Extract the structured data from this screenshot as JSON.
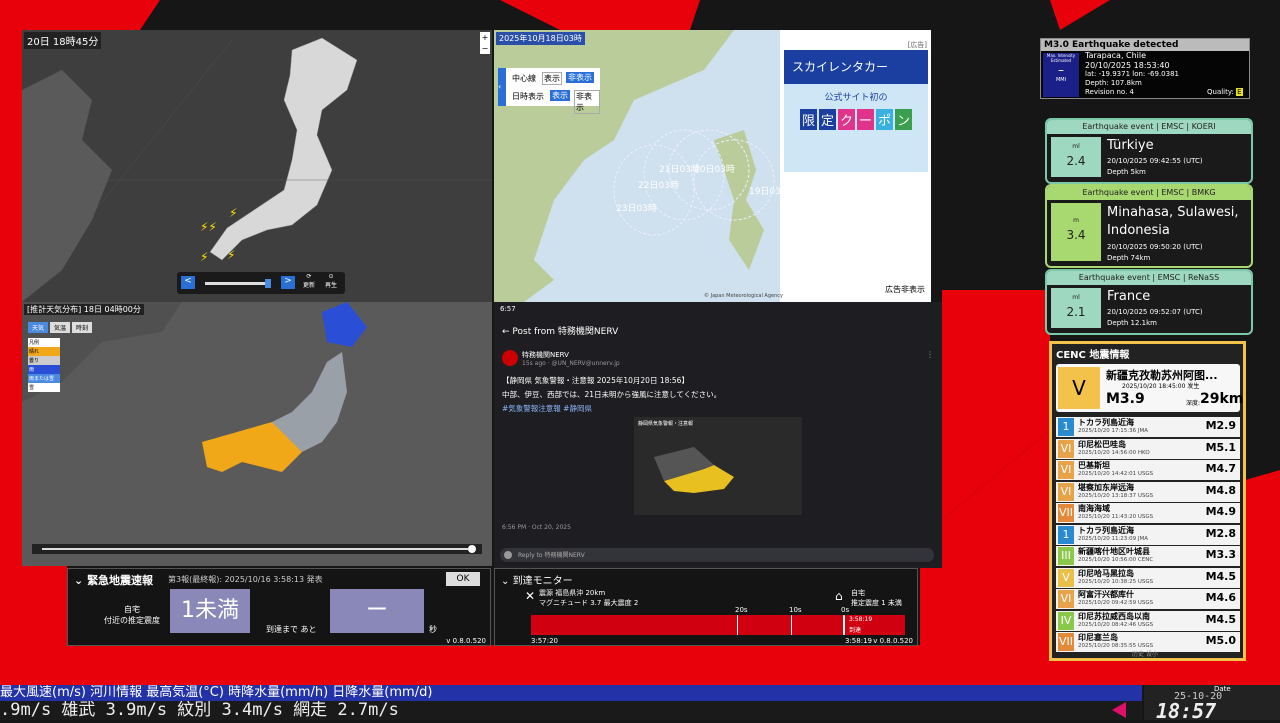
{
  "map1": {
    "timestamp": "20日 18時45分",
    "btn_prev": "<",
    "btn_next": ">",
    "btn_update": "更新",
    "btn_play": "再生"
  },
  "map2": {
    "timestamp": "2025年10月18日03時",
    "ad_label": "[広告]",
    "center_line_label": "中心線",
    "time_label": "日時表示",
    "show": "表示",
    "hide": "非表示",
    "ad_brand": "スカイレンタカー",
    "ad_sub": "公式サイト初の",
    "ad_coupon": [
      "限",
      "定",
      "ク",
      "ー",
      "ポ",
      "ン"
    ],
    "hide_ad": "広告非表示",
    "track_labels": [
      "21日03時",
      "20日03時",
      "22日03時",
      "19日03時",
      "23日03時"
    ],
    "copyright": "© Japan Meteorological Agency"
  },
  "map3": {
    "title": "[推計天気分布]",
    "time": "18日 04時00分",
    "tabs": [
      "天気",
      "気温",
      "時刻"
    ],
    "legend_title": "凡例",
    "legend": [
      "晴れ",
      "曇り",
      "雨",
      "雨または雪",
      "雪"
    ]
  },
  "post": {
    "status_time": "6:57",
    "header": "Post from 特務機関NERV",
    "author": "特務機関NERV",
    "meta": "15s ago · @UN_NERV@unnerv.jp",
    "line1": "【静岡県 気象警報・注意報 2025年10月20日 18:56】",
    "line2": "中部、伊豆、西部では、21日未明から強風に注意してください。",
    "tags": "#気象警報注意報 #静岡県",
    "image_title": "静岡県気象警報・注意報",
    "timestamp": "6:56 PM · Oct 20, 2025",
    "reply_placeholder": "Reply to 特務機関NERV"
  },
  "eew": {
    "title": "緊急地震速報",
    "sub": "第3報(最終報): 2025/10/16 3:58:13 発表",
    "ok": "OK",
    "loc_label1": "自宅",
    "loc_label2": "付近の推定震度",
    "intensity": "1未満",
    "arrive_label": "到達まで あと",
    "arrive_value": "ー",
    "unit": "秒",
    "version": "v 0.8.0.520"
  },
  "arrival": {
    "title": "到達モニター",
    "quake_label": "震源",
    "epicenter": "福島県沖 20km",
    "magnitude": "マグニチュード 3.7",
    "max_int": "最大震度 2",
    "home_label": "自宅",
    "home_int": "推定震度 1 未満",
    "ticks": [
      "20s",
      "10s",
      "0s"
    ],
    "arrived_time": "3:58:19",
    "arrived_label": "到達",
    "start_time": "3:57:20",
    "end_time": "3:58:19",
    "version": "v 0.8.0.520"
  },
  "detected": {
    "title": "M3.0 Earthquake detected",
    "badge_line": "Max. Intensity Estimated",
    "badge_value": "–",
    "badge_unit": "MMI",
    "place": "Tarapaca, Chile",
    "time": "20/10/2025 18:53:40",
    "latlon": "lat: -19.9371 lon: -69.0381",
    "depth": "Depth: 107.8km",
    "revision": "Revision no. 4",
    "quality_label": "Quality:",
    "quality": "E"
  },
  "events": [
    {
      "header": "Earthquake event | EMSC | KOERI",
      "unit": "ml",
      "mag": "2.4",
      "place": "Türkiye",
      "time": "20/10/2025 09:42:55 (UTC)",
      "depth": "Depth 5km"
    },
    {
      "header": "Earthquake event | EMSC | BMKG",
      "unit": "m",
      "mag": "3.4",
      "place": "Minahasa, Sulawesi, Indonesia",
      "time": "20/10/2025 09:50:20 (UTC)",
      "depth": "Depth 74km"
    },
    {
      "header": "Earthquake event | EMSC | ReNaSS",
      "unit": "ml",
      "mag": "2.1",
      "place": "France",
      "time": "20/10/2025 09:52:07 (UTC)",
      "depth": "Depth 12.1km"
    }
  ],
  "cenc": {
    "title": "CENC 地震情報",
    "main": {
      "int": "V",
      "place": "新疆克孜勒苏州阿图...",
      "time": "2025/10/20 18:45:00 发生",
      "mag": "M3.9",
      "depth_label": "深度:",
      "depth": "29km"
    },
    "list": [
      {
        "int": "1",
        "name": "トカラ列島近海",
        "time": "2025/10/20 17:15:36",
        "src": "JMA",
        "mag": "M2.9",
        "color": "#2a8ad0"
      },
      {
        "int": "VI",
        "name": "印尼松巴哇岛",
        "time": "2025/10/20 14:56:00",
        "src": "HKO",
        "mag": "M5.1",
        "color": "#e8a24a"
      },
      {
        "int": "VI",
        "name": "巴基斯坦",
        "time": "2025/10/20 14:42:01",
        "src": "USGS",
        "mag": "M4.7",
        "color": "#e8a24a"
      },
      {
        "int": "VI",
        "name": "堪察加东岸远海",
        "time": "2025/10/20 13:18:37",
        "src": "USGS",
        "mag": "M4.8",
        "color": "#e8a24a"
      },
      {
        "int": "VII",
        "name": "南海海域",
        "time": "2025/10/20 11:43:20",
        "src": "USGS",
        "mag": "M4.9",
        "color": "#e28a3a"
      },
      {
        "int": "1",
        "name": "トカラ列島近海",
        "time": "2025/10/20 11:23:09",
        "src": "JMA",
        "mag": "M2.8",
        "color": "#2a8ad0"
      },
      {
        "int": "III",
        "name": "新疆喀什地区叶城县",
        "time": "2025/10/20 10:56:00",
        "src": "CENC",
        "mag": "M3.3",
        "color": "#8ac84a"
      },
      {
        "int": "V",
        "name": "印尼哈马黑拉岛",
        "time": "2025/10/20 10:38:25",
        "src": "USGS",
        "mag": "M4.5",
        "color": "#e8c04a"
      },
      {
        "int": "VI",
        "name": "阿富汗兴都库什",
        "time": "2025/10/20 09:42:59",
        "src": "USGS",
        "mag": "M4.6",
        "color": "#e8a24a"
      },
      {
        "int": "IV",
        "name": "印尼苏拉威西岛以南",
        "time": "2025/10/20 08:42:46",
        "src": "USGS",
        "mag": "M4.5",
        "color": "#8ac84a"
      },
      {
        "int": "VII",
        "name": "印尼塞兰岛",
        "time": "2025/10/20 08:35:55",
        "src": "USGS",
        "mag": "M5.0",
        "color": "#e28a3a"
      }
    ],
    "footer": [
      "历史",
      "设小"
    ]
  },
  "ticker": {
    "row1": "最大風速(m/s)  河川情報      最高気温(°C)    時降水量(mm/h)   日降水量(mm/d)",
    "row2": ".9m/s    雄武  3.9m/s    紋別  3.4m/s    網走  2.7m/s"
  },
  "clock": {
    "label": "Date",
    "date": "25-10-20",
    "time": "18:57"
  }
}
